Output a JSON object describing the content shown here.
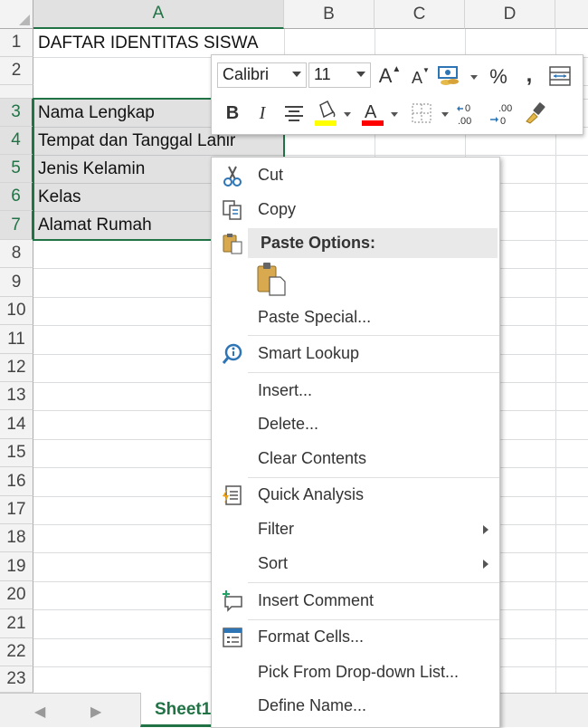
{
  "columns": [
    "A",
    "B",
    "C",
    "D"
  ],
  "rows": [
    "1",
    "2",
    "3",
    "4",
    "5",
    "6",
    "7",
    "8",
    "9",
    "10",
    "11",
    "12",
    "13",
    "14",
    "15",
    "16",
    "17",
    "18",
    "19",
    "20",
    "21",
    "22",
    "23"
  ],
  "cells": {
    "a1": "DAFTAR IDENTITAS SISWA",
    "a3": "Nama Lengkap",
    "a4": "Tempat dan Tanggal Lahir",
    "a5": "Jenis Kelamin",
    "a6": "Kelas",
    "a7": "Alamat Rumah"
  },
  "sheet_tab": "Sheet1",
  "mini_toolbar": {
    "font_name": "Calibri",
    "font_size": "11",
    "increase_font": "A",
    "decrease_font": "A",
    "percent": "%",
    "comma": ",",
    "bold": "B",
    "italic": "I",
    "font_color_letter": "A",
    "increase_decimal": ".00",
    "decrease_decimal": ".00",
    "fill_color": "#ffff00",
    "font_color": "#ff0000"
  },
  "context_menu": {
    "cut": "Cut",
    "copy": "Copy",
    "paste_options": "Paste Options:",
    "paste_special": "Paste Special...",
    "smart_lookup": "Smart Lookup",
    "insert": "Insert...",
    "delete": "Delete...",
    "clear_contents": "Clear Contents",
    "quick_analysis": "Quick Analysis",
    "filter": "Filter",
    "sort": "Sort",
    "insert_comment": "Insert Comment",
    "format_cells": "Format Cells...",
    "pick_from_list": "Pick From Drop-down List...",
    "define_name": "Define Name..."
  },
  "colors": {
    "excel_green": "#217346",
    "selection_border": "#217346"
  }
}
